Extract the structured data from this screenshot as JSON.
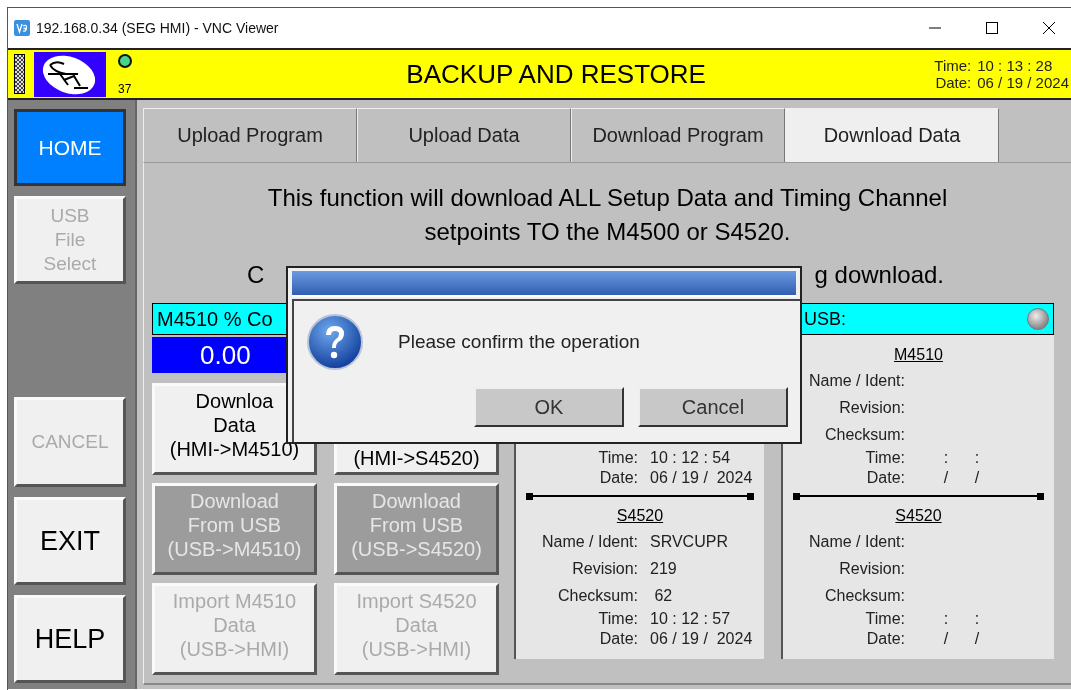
{
  "window": {
    "title": "192.168.0.34 (SEG HMI) - VNC Viewer"
  },
  "header": {
    "counter": "37",
    "title": "BACKUP AND RESTORE",
    "time_label": "Time:",
    "time": "10 : 13 : 28",
    "date_label": "Date:",
    "date": "06 / 19 / 2024"
  },
  "sidebar": {
    "buttons": [
      {
        "label": "HOME",
        "selected": true,
        "disabled": false
      },
      {
        "label": "USB\nFile\nSelect",
        "selected": false,
        "disabled": true
      },
      {
        "label": "CANCEL",
        "selected": false,
        "disabled": true
      },
      {
        "label": "EXIT",
        "selected": false,
        "disabled": false
      },
      {
        "label": "HELP",
        "selected": false,
        "disabled": false
      }
    ]
  },
  "tabs": [
    {
      "label": "Upload Program",
      "selected": false
    },
    {
      "label": "Upload Data",
      "selected": false
    },
    {
      "label": "Download Program",
      "selected": false
    },
    {
      "label": "Download Data",
      "selected": true
    }
  ],
  "instruction": "This function will download ALL Setup Data and Timing Channel setpoints TO the M4500 or S4520.",
  "note_fragments": [
    "C",
    "g download."
  ],
  "m4510_meter": {
    "header": "M4510 % Co",
    "value": "0.00"
  },
  "action_buttons": [
    {
      "label": "Downloa\nData\n(HMI->M4510)",
      "disabled": false,
      "shaded": false
    },
    {
      "label": "(HMI->S4520)",
      "disabled": false,
      "shaded": false
    },
    {
      "label": "Download\nFrom USB\n(USB->M4510)",
      "disabled": true,
      "shaded": true
    },
    {
      "label": "Download\nFrom USB\n(USB->S4520)",
      "disabled": true,
      "shaded": true
    },
    {
      "label": "Import M4510\nData\n(USB->HMI)",
      "disabled": true,
      "shaded": false
    },
    {
      "label": "Import S4520\nData\n(USB->HMI)",
      "disabled": true,
      "shaded": false
    }
  ],
  "controller_panel": {
    "sections": [
      {
        "rows": [
          {
            "label": "Time:",
            "value": "10 : 12 : 54",
            "kind": "stamp"
          },
          {
            "label": "Date:",
            "value": "06 / 19 /  2024",
            "kind": "stamp"
          }
        ]
      },
      {
        "title": "S4520",
        "rows": [
          {
            "label": "Name / Ident:",
            "value": "SRVCUPR",
            "kind": "field"
          },
          {
            "label": "Revision:",
            "value": "219",
            "kind": "field"
          },
          {
            "label": "Checksum:",
            "value": " 62",
            "kind": "field"
          },
          {
            "label": "Time:",
            "value": "10 : 12 : 57",
            "kind": "stamp"
          },
          {
            "label": "Date:",
            "value": "06 / 19 /  2024",
            "kind": "stamp"
          }
        ]
      }
    ]
  },
  "usb_panel": {
    "header": "USB:",
    "sections": [
      {
        "title": "M4510",
        "rows": [
          {
            "label": "Name / Ident:",
            "kind": "field"
          },
          {
            "label": "Revision:",
            "kind": "field"
          },
          {
            "label": "Checksum:",
            "kind": "field"
          },
          {
            "label": "Time:",
            "value": "      :      :",
            "kind": "stamp"
          },
          {
            "label": "Date:",
            "value": "      /      /",
            "kind": "stamp"
          }
        ]
      },
      {
        "title": "S4520",
        "rows": [
          {
            "label": "Name / Ident:",
            "kind": "field"
          },
          {
            "label": "Revision:",
            "kind": "field"
          },
          {
            "label": "Checksum:",
            "kind": "field"
          },
          {
            "label": "Time:",
            "value": "      :      :",
            "kind": "stamp"
          },
          {
            "label": "Date:",
            "value": "      /      /",
            "kind": "stamp"
          }
        ]
      }
    ]
  },
  "dialog": {
    "message": "Please confirm the operation",
    "buttons": [
      "OK",
      "Cancel"
    ]
  }
}
